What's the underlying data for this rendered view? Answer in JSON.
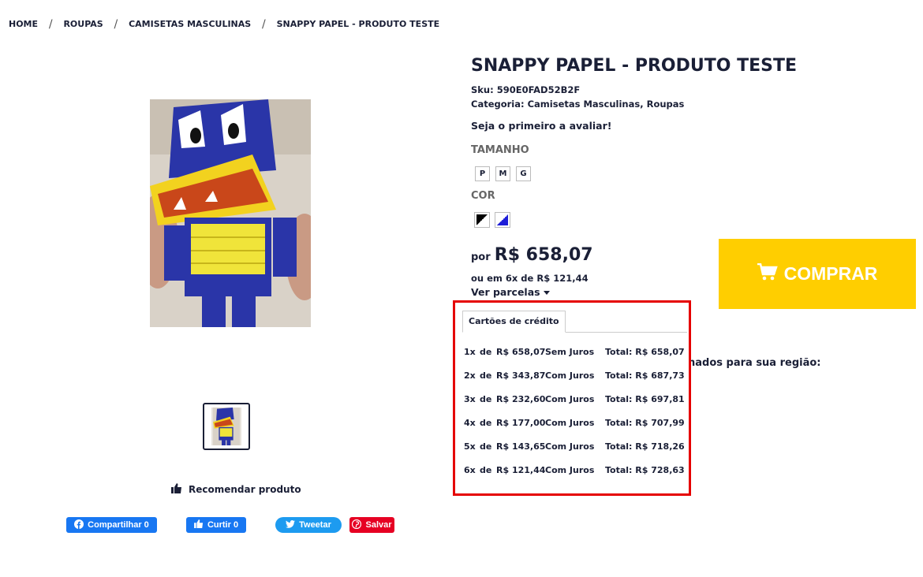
{
  "breadcrumb": [
    "HOME",
    "ROUPAS",
    "CAMISETAS MASCULINAS",
    "SNAPPY PAPEL - PRODUTO TESTE"
  ],
  "product": {
    "title": "SNAPPY PAPEL - PRODUTO TESTE",
    "sku": "Sku: 590E0FAD52B2F",
    "category": "Categoria: Camisetas Masculinas,  Roupas",
    "review_prompt": "Seja o primeiro a avaliar!",
    "size_label": "TAMANHO",
    "sizes": [
      "P",
      "M",
      "G"
    ],
    "color_label": "COR",
    "price_prefix": "por",
    "price": "R$ 658,07",
    "installment_text": "ou em 6x de R$ 121,44",
    "ver_parcelas": "Ver parcelas"
  },
  "buy_button": "COMPRAR",
  "shipping_partial": "nados para sua região:",
  "recommend": "Recomendar produto",
  "social": {
    "fb_share": "Compartilhar 0",
    "fb_like": "Curtir 0",
    "tweet": "Tweetar",
    "pin": "Salvar"
  },
  "installments": {
    "tab": "Cartões de crédito",
    "rows": [
      {
        "n": "1x",
        "de": "de",
        "value": "R$ 658,07",
        "juros": "Sem Juros",
        "total": "Total: R$ 658,07"
      },
      {
        "n": "2x",
        "de": "de",
        "value": "R$ 343,87",
        "juros": "Com Juros",
        "total": "Total: R$ 687,73"
      },
      {
        "n": "3x",
        "de": "de",
        "value": "R$ 232,60",
        "juros": "Com Juros",
        "total": "Total: R$ 697,81"
      },
      {
        "n": "4x",
        "de": "de",
        "value": "R$ 177,00",
        "juros": "Com Juros",
        "total": "Total: R$ 707,99"
      },
      {
        "n": "5x",
        "de": "de",
        "value": "R$ 143,65",
        "juros": "Com Juros",
        "total": "Total: R$ 718,26"
      },
      {
        "n": "6x",
        "de": "de",
        "value": "R$ 121,44",
        "juros": "Com Juros",
        "total": "Total: R$ 728,63"
      }
    ]
  },
  "colors": {
    "buy": "#ffce00",
    "highlight_border": "#e50000",
    "facebook": "#1877f2",
    "twitter": "#1d9bf0",
    "pinterest": "#e60023"
  }
}
